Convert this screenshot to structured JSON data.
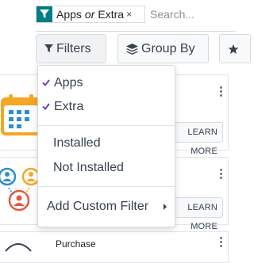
{
  "search": {
    "facet_values": [
      "Apps",
      "Extra"
    ],
    "facet_separator": "or",
    "facet_remove_glyph": "×",
    "placeholder": "Search..."
  },
  "toolbar": {
    "filters_label": "Filters",
    "group_by_label": "Group By"
  },
  "filter_menu": {
    "items": [
      {
        "label": "Apps",
        "checked": true
      },
      {
        "label": "Extra",
        "checked": true
      },
      {
        "label": "Installed",
        "checked": false
      },
      {
        "label": "Not Installed",
        "checked": false
      }
    ],
    "custom_filter_label": "Add Custom Filter"
  },
  "kanban": {
    "cards": [
      {
        "title": "",
        "button_label": "LEARN MORE",
        "icon": "calendar-icon"
      },
      {
        "title": "",
        "button_label": "LEARN MORE",
        "icon": "contacts-icon"
      },
      {
        "title": "Purchase",
        "button_label": "",
        "icon": "purchase-icon"
      }
    ]
  },
  "colors": {
    "accent": "#017e84",
    "check": "#6f42c1",
    "icon_orange": "#f5a623",
    "icon_blue": "#2a8fd1",
    "icon_red": "#e8553e"
  }
}
